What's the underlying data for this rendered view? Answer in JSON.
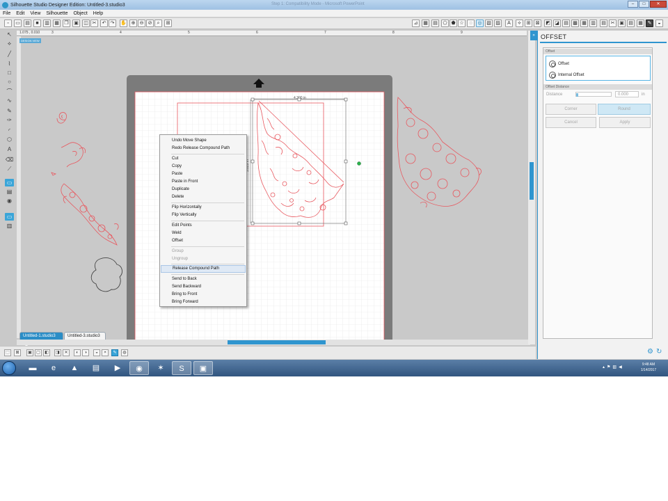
{
  "window": {
    "title": "Silhouette Studio Designer Edition: Untitled-3.studio3",
    "faint_title": "Step 1: Compatibility Mode - Microsoft PowerPoint",
    "buttons": {
      "minimize": "–",
      "maximize": "□",
      "close": "✕"
    }
  },
  "menubar": [
    "File",
    "Edit",
    "View",
    "Silhouette",
    "Object",
    "Help"
  ],
  "ruler": {
    "badge": "DESIGN VIEW",
    "marks": [
      "3",
      "4",
      "5",
      "6",
      "7",
      "8",
      "9"
    ],
    "mark_left": "1.075 , 0.010"
  },
  "selection": {
    "width_label": "4.300 in",
    "height_label": "5.829 in"
  },
  "context_menu": {
    "items": [
      {
        "label": "Undo Move Shape",
        "enabled": true
      },
      {
        "label": "Redo Release Compound Path",
        "enabled": true
      },
      {
        "label": "Cut",
        "enabled": true
      },
      {
        "label": "Copy",
        "enabled": true
      },
      {
        "label": "Paste",
        "enabled": true
      },
      {
        "label": "Paste in Front",
        "enabled": true
      },
      {
        "label": "Duplicate",
        "enabled": true
      },
      {
        "label": "Delete",
        "enabled": true
      },
      {
        "label": "Flip Horizontally",
        "enabled": true
      },
      {
        "label": "Flip Vertically",
        "enabled": true
      },
      {
        "label": "Edit Points",
        "enabled": true
      },
      {
        "label": "Weld",
        "enabled": true
      },
      {
        "label": "Offset",
        "enabled": true
      },
      {
        "label": "Group",
        "enabled": false
      },
      {
        "label": "Ungroup",
        "enabled": false
      },
      {
        "label": "Release Compound Path",
        "enabled": true,
        "highlighted": true
      },
      {
        "label": "Send to Back",
        "enabled": true
      },
      {
        "label": "Send Backward",
        "enabled": true
      },
      {
        "label": "Bring to Front",
        "enabled": true
      },
      {
        "label": "Bring Forward",
        "enabled": true
      }
    ]
  },
  "tabs": [
    {
      "label": "Untitled-1.studio3",
      "active": true
    },
    {
      "label": "Untitled-3.studio3",
      "active": false
    }
  ],
  "panel": {
    "title": "OFFSET",
    "section_offset": "Offset",
    "option_offset": "Offset",
    "option_internal": "Internal Offset",
    "section_distance": "Offset Distance",
    "distance_label": "Distance",
    "distance_value": "0.000",
    "distance_unit": "in",
    "corner_button": "Corner",
    "round_button": "Round",
    "cancel_button": "Cancel",
    "apply_button": "Apply"
  },
  "taskbar": {
    "time": "9:48 AM",
    "date": "1/14/2017"
  },
  "colors": {
    "accent": "#2f95cf",
    "cut_line": "#e8585f",
    "mat": "#7b7b7b"
  }
}
